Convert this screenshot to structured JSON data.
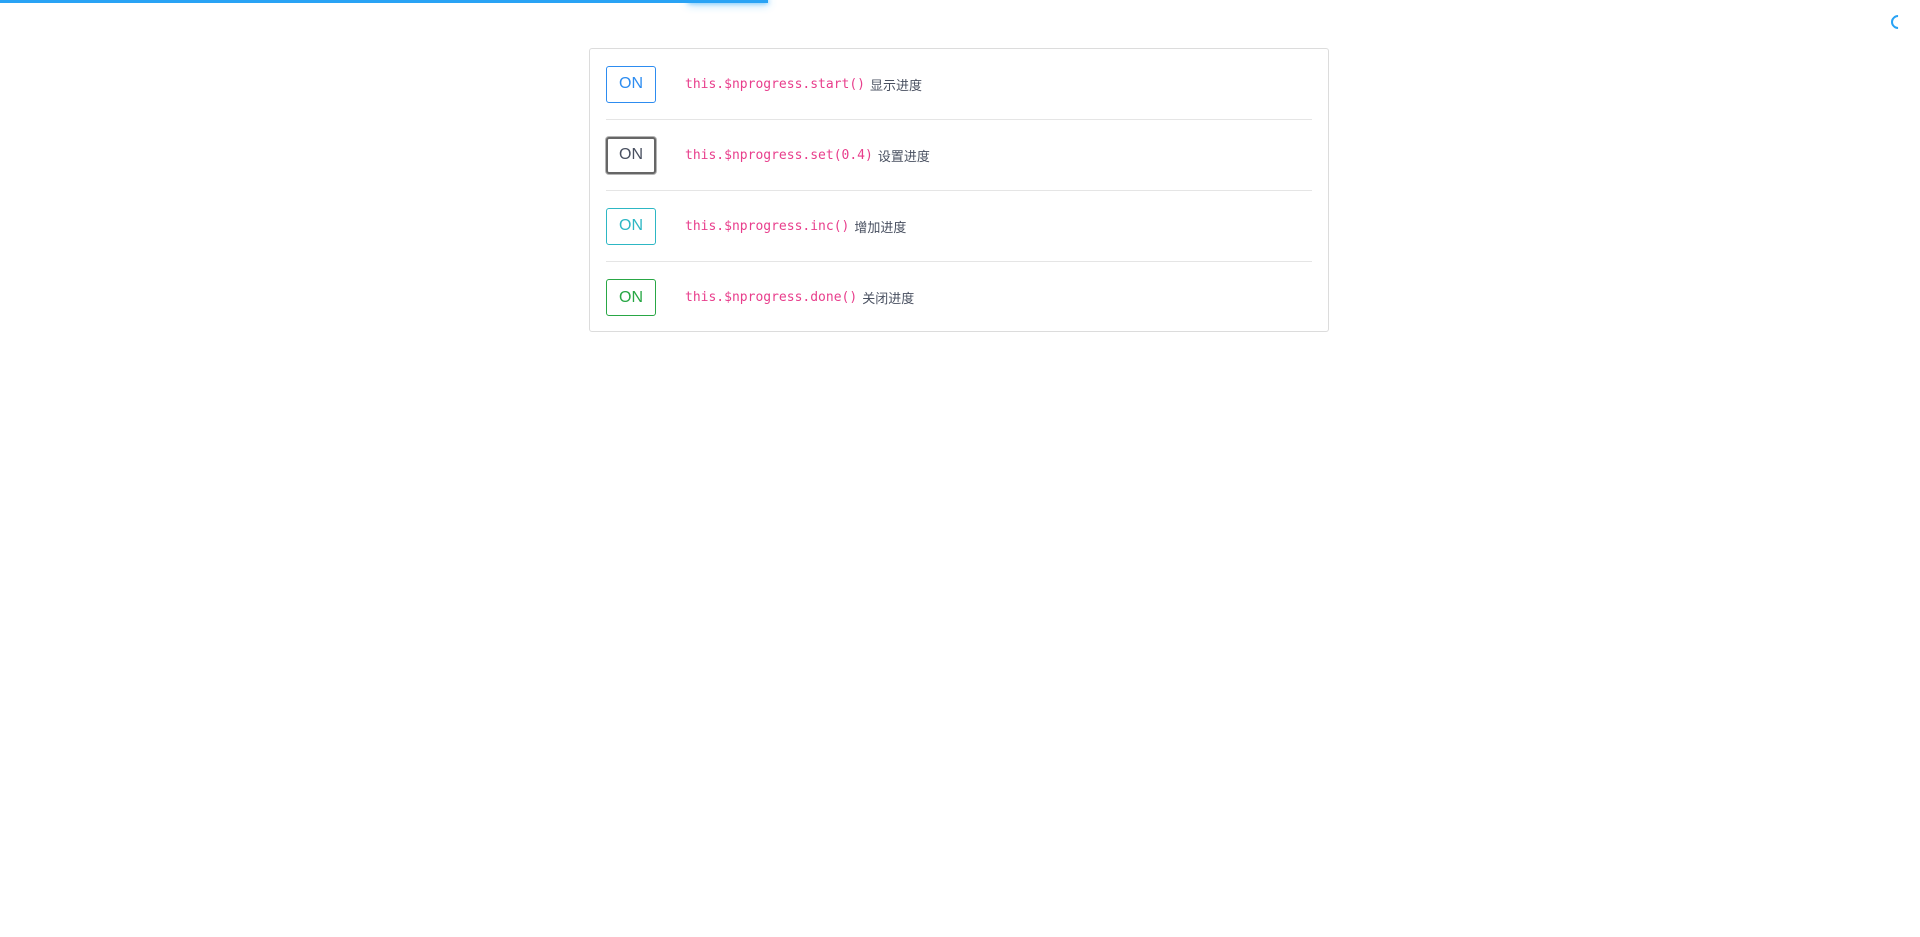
{
  "progress": {
    "value": 0.4,
    "color": "#29a3f5"
  },
  "spinner": {
    "icon": "loading-spinner-icon"
  },
  "rows": [
    {
      "button_label": "ON",
      "button_color": "#2d8cf0",
      "code": "this.$nprogress.start()",
      "label": "显示进度"
    },
    {
      "button_label": "ON",
      "button_color": "#495060",
      "code": "this.$nprogress.set(0.4)",
      "label": "设置进度"
    },
    {
      "button_label": "ON",
      "button_color": "#2db7c4",
      "code": "this.$nprogress.inc()",
      "label": "增加进度"
    },
    {
      "button_label": "ON",
      "button_color": "#28a745",
      "code": "this.$nprogress.done()",
      "label": "关闭进度"
    }
  ]
}
